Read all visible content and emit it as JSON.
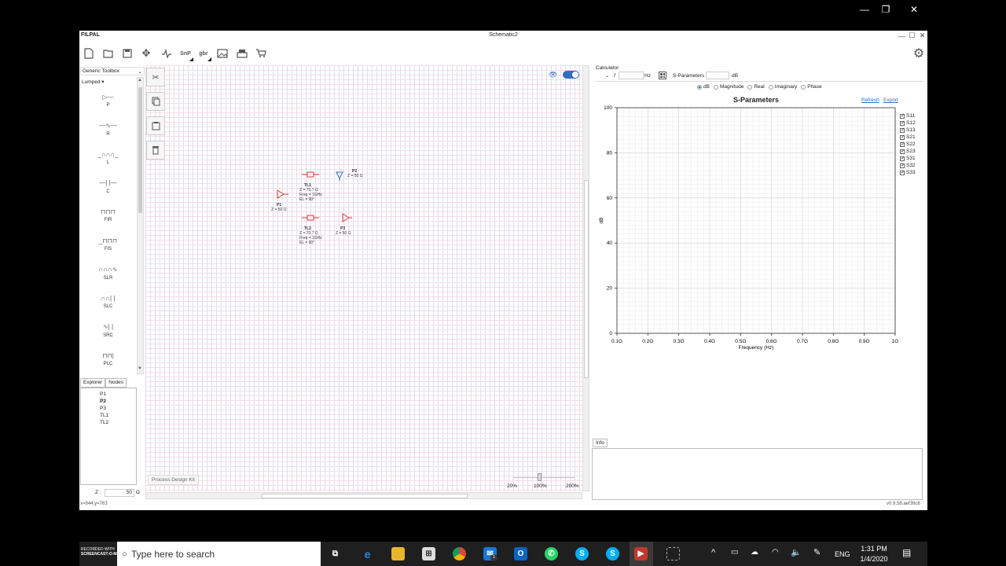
{
  "app": {
    "name": "FILPAL",
    "doc_title": "Schematic2",
    "version": "v0.9.58.aef39c6",
    "cursor_pos": "x=944,y=763"
  },
  "outer_window": {
    "minimize": "—",
    "maximize": "❐",
    "close": "✕"
  },
  "inner_window": {
    "minimize": "—",
    "maximize": "☐",
    "close": "✕"
  },
  "toolbar": {
    "snp": "SnP",
    "gbr": "gbr"
  },
  "toolbox": {
    "selector": "Generic Toolbox",
    "category": "Lumped ▾",
    "items": [
      {
        "label": "P",
        "icon": "port-icon",
        "glyph": "▷—"
      },
      {
        "label": "R",
        "icon": "resistor-icon",
        "glyph": "—∿—"
      },
      {
        "label": "L",
        "icon": "inductor-icon",
        "glyph": "_∩∩∩_"
      },
      {
        "label": "C",
        "icon": "capacitor-icon",
        "glyph": "—| |—"
      },
      {
        "label": "FIR",
        "icon": "fir-icon",
        "glyph": "⊓⊓⊓"
      },
      {
        "label": "FIS",
        "icon": "fis-icon",
        "glyph": "_⊓⊓⊓"
      },
      {
        "label": "SLR",
        "icon": "slr-icon",
        "glyph": "∩∩∩∿"
      },
      {
        "label": "SLC",
        "icon": "slc-icon",
        "glyph": "∩∩| |"
      },
      {
        "label": "SRC",
        "icon": "src-icon",
        "glyph": "∿| |"
      },
      {
        "label": "PLC",
        "icon": "plc-icon",
        "glyph": "⊓⊓|"
      }
    ]
  },
  "explorer": {
    "tabs": [
      "Explorer",
      "Nodes"
    ],
    "items": [
      "P1",
      "P2",
      "P3",
      "TL1",
      "TL2"
    ],
    "bold_item": "P2"
  },
  "impedance": {
    "label": "Z :",
    "value": "50",
    "unit": "Ω"
  },
  "canvas": {
    "pdk_label": "Process Design Kit",
    "zoom_labels": [
      "20%",
      "100%",
      "200%"
    ],
    "components": [
      {
        "name": "P1",
        "lines": [
          "Z = 50 Ω"
        ]
      },
      {
        "name": "TL1",
        "lines": [
          "Z = 70.7 Ω",
          "Freq = 1GHz",
          "EL = 90°"
        ]
      },
      {
        "name": "P2",
        "lines": [
          "Z = 50 Ω"
        ]
      },
      {
        "name": "TL2",
        "lines": [
          "Z = 70.7 Ω",
          "Freq = 1GHz",
          "EL = 90°"
        ]
      },
      {
        "name": "P3",
        "lines": [
          "Z = 50 Ω"
        ]
      }
    ]
  },
  "calculator": {
    "title": "Calculator",
    "f_label": "f",
    "f_value": "",
    "f_unit": "Hz",
    "sparams_label": "S-Parameters",
    "sparams_value": "",
    "sparams_unit": "dB"
  },
  "display_modes": {
    "options": [
      "dB",
      "Magnitude",
      "Real",
      "Imaginary",
      "Phase"
    ],
    "selected": "dB"
  },
  "chart_links": {
    "refresh": "Refresh",
    "export": "Export"
  },
  "info": {
    "tab": "Info"
  },
  "chart_data": {
    "type": "line",
    "title": "S-Parameters",
    "xlabel": "Frequency (Hz)",
    "ylabel": "dB",
    "x_ticks": [
      "0.1G",
      "0.2G",
      "0.3G",
      "0.4G",
      "0.5G",
      "0.6G",
      "0.7G",
      "0.8G",
      "0.9G",
      "1G"
    ],
    "y_ticks": [
      "0",
      "20",
      "40",
      "60",
      "80",
      "100"
    ],
    "xlim": [
      0.1,
      1.0
    ],
    "ylim": [
      0,
      100
    ],
    "grid": true,
    "legend": "right",
    "series": [
      {
        "name": "S11",
        "checked": true,
        "values": []
      },
      {
        "name": "S12",
        "checked": true,
        "values": []
      },
      {
        "name": "S13",
        "checked": true,
        "values": []
      },
      {
        "name": "S21",
        "checked": true,
        "values": []
      },
      {
        "name": "S22",
        "checked": true,
        "values": []
      },
      {
        "name": "S23",
        "checked": true,
        "values": []
      },
      {
        "name": "S31",
        "checked": true,
        "values": []
      },
      {
        "name": "S32",
        "checked": true,
        "values": []
      },
      {
        "name": "S33",
        "checked": true,
        "values": []
      }
    ]
  },
  "taskbar": {
    "search_placeholder": "Type here to search",
    "watermark_top": "RECORDED WITH",
    "watermark_bottom": "SCREENCAST-O-MATIC",
    "time": "1:31 PM",
    "date": "1/4/2020",
    "lang": "ENG",
    "mail_badge": "1"
  },
  "colors": {
    "accent": "#2f6fc0",
    "component_red": "#d33b3b",
    "taskbar_bg": "#1f1f1f"
  }
}
